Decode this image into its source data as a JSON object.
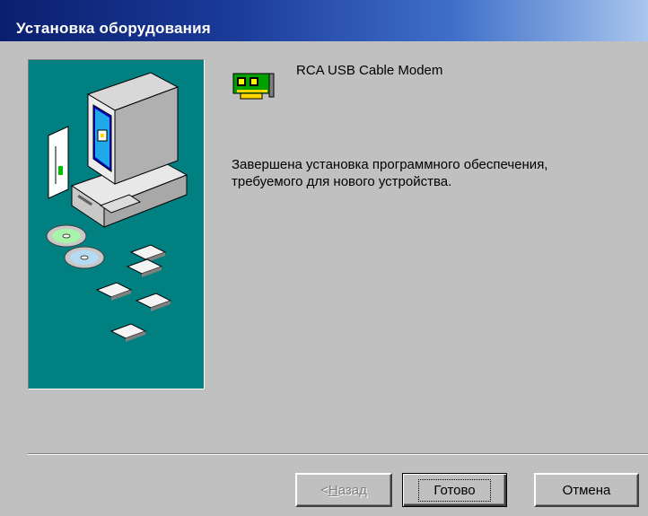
{
  "window": {
    "title": "Установка оборудования"
  },
  "device": {
    "icon": "network-card-icon",
    "name": "RCA USB Cable Modem"
  },
  "message": {
    "line1": "Завершена установка программного обеспечения,",
    "line2": "требуемого для нового устройства."
  },
  "buttons": {
    "back_prefix": "< ",
    "back_accel": "Н",
    "back_rest": "азад",
    "back_enabled": false,
    "finish": "Готово",
    "cancel": "Отмена"
  },
  "colors": {
    "title_gradient_start": "#0a1f6e",
    "title_gradient_end": "#a9c6ee",
    "dialog_face": "#c0c0c0",
    "wizard_panel": "#008080"
  }
}
